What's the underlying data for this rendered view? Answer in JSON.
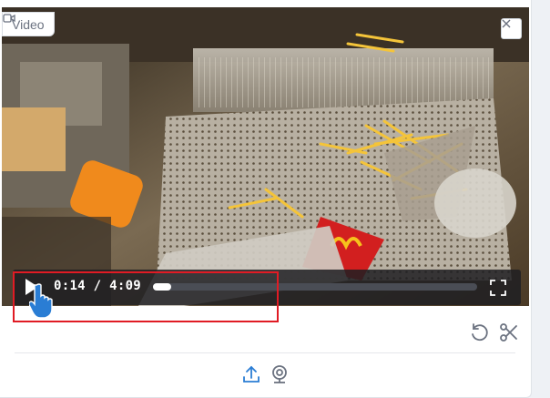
{
  "video": {
    "tag_label": "Video",
    "tag_icon": "video-camera-icon",
    "close_icon": "close-icon"
  },
  "player": {
    "current_time": "0:14",
    "separator": "/",
    "duration": "4:09",
    "progress_fraction": 0.056,
    "play_icon": "play-icon",
    "fullscreen_icon": "fullscreen-icon"
  },
  "toolbar": {
    "undo_icon": "undo-icon",
    "scissors_icon": "scissors-icon",
    "upload_icon": "upload-icon",
    "webcam_icon": "webcam-icon"
  },
  "colors": {
    "highlight": "#e01b24",
    "accent": "#2a7dd4",
    "controls_bg": "#1e1e22"
  }
}
